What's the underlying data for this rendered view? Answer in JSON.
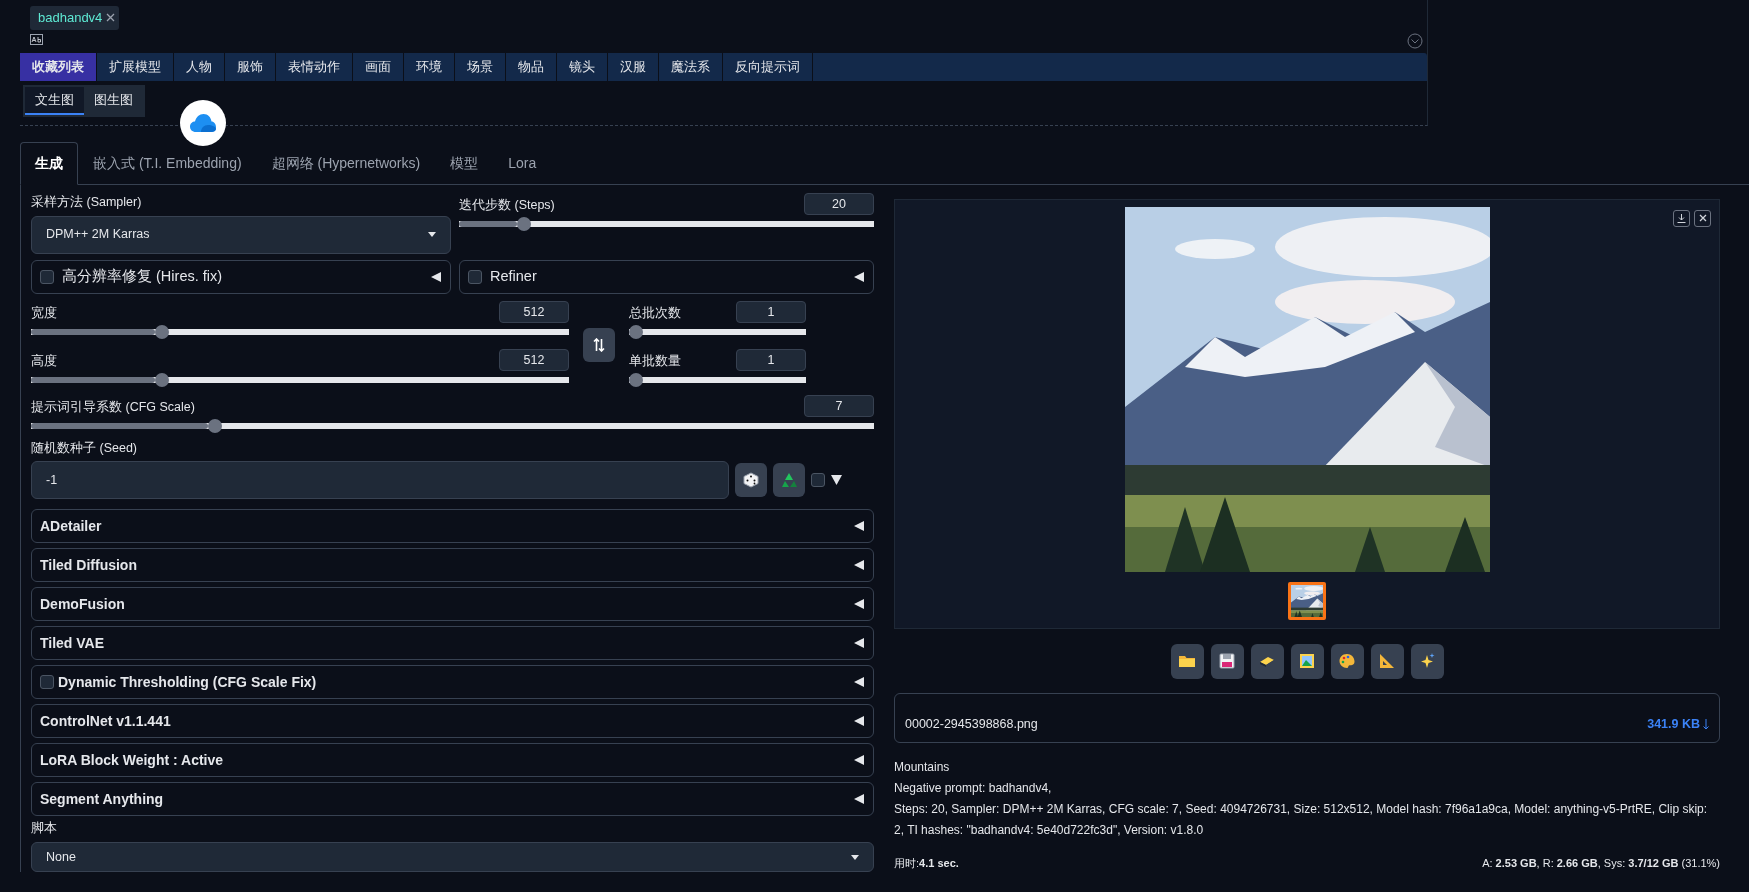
{
  "prompt_tags": [
    {
      "label": "badhandv4"
    }
  ],
  "category_tabs": [
    {
      "label": "收藏列表",
      "selected": true
    },
    {
      "label": "扩展模型",
      "selected": false
    },
    {
      "label": "人物",
      "selected": false
    },
    {
      "label": "服饰",
      "selected": false
    },
    {
      "label": "表情动作",
      "selected": false
    },
    {
      "label": "画面",
      "selected": false
    },
    {
      "label": "环境",
      "selected": false
    },
    {
      "label": "场景",
      "selected": false
    },
    {
      "label": "物品",
      "selected": false
    },
    {
      "label": "镜头",
      "selected": false
    },
    {
      "label": "汉服",
      "selected": false
    },
    {
      "label": "魔法系",
      "selected": false
    },
    {
      "label": "反向提示词",
      "selected": false
    }
  ],
  "mode_tabs": [
    {
      "label": "文生图",
      "selected": true
    },
    {
      "label": "图生图",
      "selected": false
    }
  ],
  "main_tabs": [
    {
      "label": "生成",
      "selected": true
    },
    {
      "label": "嵌入式 (T.I. Embedding)",
      "selected": false
    },
    {
      "label": "超网络 (Hypernetworks)",
      "selected": false
    },
    {
      "label": "模型",
      "selected": false
    },
    {
      "label": "Lora",
      "selected": false
    }
  ],
  "sampler": {
    "label": "采样方法 (Sampler)",
    "value": "DPM++ 2M Karras"
  },
  "steps": {
    "label": "迭代步数 (Steps)",
    "value": "20",
    "level": 0.14
  },
  "hires_fix": {
    "label": "高分辨率修复 (Hires. fix)",
    "checked": false
  },
  "refiner": {
    "label": "Refiner",
    "checked": false
  },
  "width": {
    "label": "宽度",
    "value": "512",
    "level": 0.23
  },
  "height": {
    "label": "高度",
    "value": "512",
    "level": 0.23
  },
  "batch_count": {
    "label": "总批次数",
    "value": "1",
    "level": 0
  },
  "batch_size": {
    "label": "单批数量",
    "value": "1",
    "level": 0
  },
  "cfg_scale": {
    "label": "提示词引导系数 (CFG Scale)",
    "value": "7",
    "level": 0.21
  },
  "seed": {
    "label": "随机数种子 (Seed)",
    "value": "-1",
    "extra_checked": false
  },
  "accordions": [
    {
      "kind": "plain",
      "label": "ADetailer"
    },
    {
      "kind": "plain",
      "label": "Tiled Diffusion"
    },
    {
      "kind": "plain",
      "label": "DemoFusion"
    },
    {
      "kind": "plain",
      "label": "Tiled VAE"
    },
    {
      "kind": "checkbox",
      "label": "Dynamic Thresholding (CFG Scale Fix)",
      "checked": false
    },
    {
      "kind": "plain",
      "label": "ControlNet v1.1.441"
    },
    {
      "kind": "plain",
      "label": "LoRA Block Weight : Active"
    },
    {
      "kind": "plain",
      "label": "Segment Anything"
    }
  ],
  "script": {
    "label": "脚本",
    "value": "None"
  },
  "gallery": {
    "thumbnails": [
      {
        "selected": true
      }
    ]
  },
  "file": {
    "name": "00002-2945398868.png",
    "size": "341.9 KB"
  },
  "info": {
    "prompt": "Mountains",
    "negative": "Negative prompt: badhandv4,",
    "params": "Steps: 20, Sampler: DPM++ 2M Karras, CFG scale: 7, Seed: 4094726731, Size: 512x512, Model hash: 7f96a1a9ca, Model: anything-v5-PrtRE, Clip skip: 2, TI hashes: \"badhandv4: 5e40d722fc3d\", Version: v1.8.0"
  },
  "time": "用时:**4.1 sec.**",
  "memory": "A: **2.53 GB**, R: **2.66 GB**, Sys: **3.7/12 GB** (31.1%)"
}
